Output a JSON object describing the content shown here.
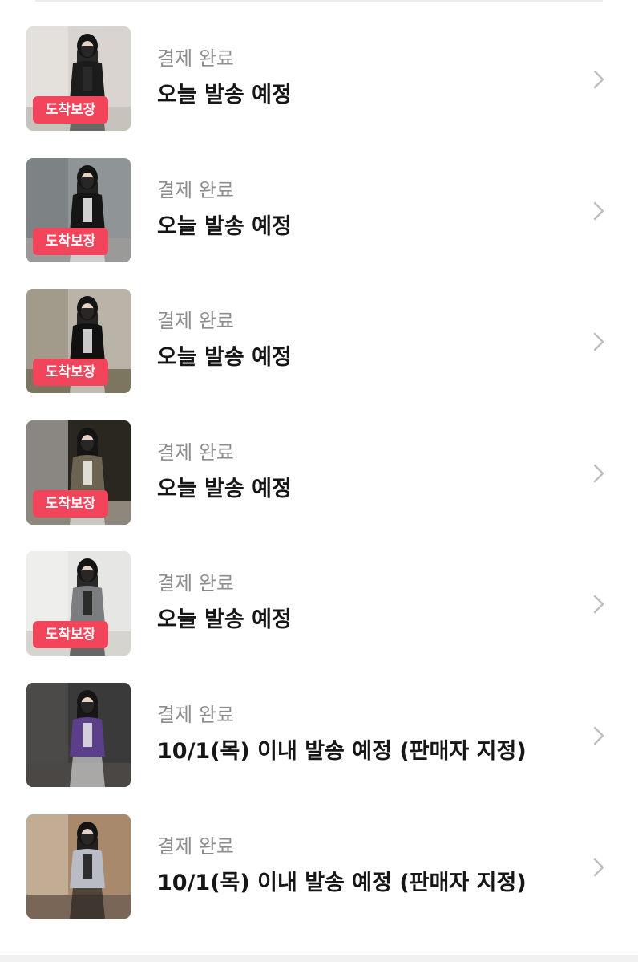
{
  "orders": [
    {
      "status": "결제 완료",
      "shipping": "오늘 발송 예정",
      "badge": "도착보장",
      "has_badge": true,
      "thumb_icon": "product-photo-black-cardigan",
      "thumb": {
        "bg": "#d9d4cf",
        "bg2": "#ece9e6",
        "figure": "#1c1c1c",
        "accent": "#2b2b2b",
        "floor": "#c7c2bc"
      }
    },
    {
      "status": "결제 완료",
      "shipping": "오늘 발송 예정",
      "badge": "도착보장",
      "has_badge": true,
      "thumb_icon": "product-photo-black-jacket-street",
      "thumb": {
        "bg": "#8f9597",
        "bg2": "#6f7476",
        "figure": "#151515",
        "accent": "#f2f2f2",
        "floor": "#9a9a98"
      }
    },
    {
      "status": "결제 완료",
      "shipping": "오늘 발송 예정",
      "badge": "도착보장",
      "has_badge": true,
      "thumb_icon": "product-photo-white-top-park",
      "thumb": {
        "bg": "#b9b3a8",
        "bg2": "#8f8672",
        "figure": "#111111",
        "accent": "#ecebea",
        "floor": "#7c7660"
      }
    },
    {
      "status": "결제 완료",
      "shipping": "오늘 발송 예정",
      "badge": "도착보장",
      "has_badge": true,
      "thumb_icon": "product-photo-cargo-pants",
      "thumb": {
        "bg": "#2a2620",
        "bg2": "#d8d6d1",
        "figure": "#6c6450",
        "accent": "#f4f2ee",
        "floor": "#8d877c"
      }
    },
    {
      "status": "결제 완료",
      "shipping": "오늘 발송 예정",
      "badge": "도착보장",
      "has_badge": true,
      "thumb_icon": "product-photo-grey-tee-room",
      "thumb": {
        "bg": "#e6e6e4",
        "bg2": "#f4f4f3",
        "figure": "#7b7d80",
        "accent": "#1d1d1d",
        "floor": "#d6d4cf"
      }
    },
    {
      "status": "결제 완료",
      "shipping": "10/1(목) 이내 발송 예정 (판매자 지정)",
      "badge": "",
      "has_badge": false,
      "thumb_icon": "product-photo-purple-henley",
      "thumb": {
        "bg": "#3b3a3a",
        "bg2": "#5a5855",
        "figure": "#5b3f8a",
        "accent": "#e9e9ea",
        "floor": "#4a4745"
      }
    },
    {
      "status": "결제 완료",
      "shipping": "10/1(목) 이내 발송 예정 (판매자 지정)",
      "badge": "",
      "has_badge": false,
      "thumb_icon": "product-photo-grey-longsleeve-bookstore",
      "thumb": {
        "bg": "#a9896c",
        "bg2": "#d8c9b6",
        "figure": "#b9bcc4",
        "accent": "#151515",
        "floor": "#7a6656"
      }
    }
  ],
  "colors": {
    "badge": "#f2455c",
    "status_text": "#8d8d8d",
    "shipping_text": "#161616",
    "chevron": "#bdbdbd"
  }
}
